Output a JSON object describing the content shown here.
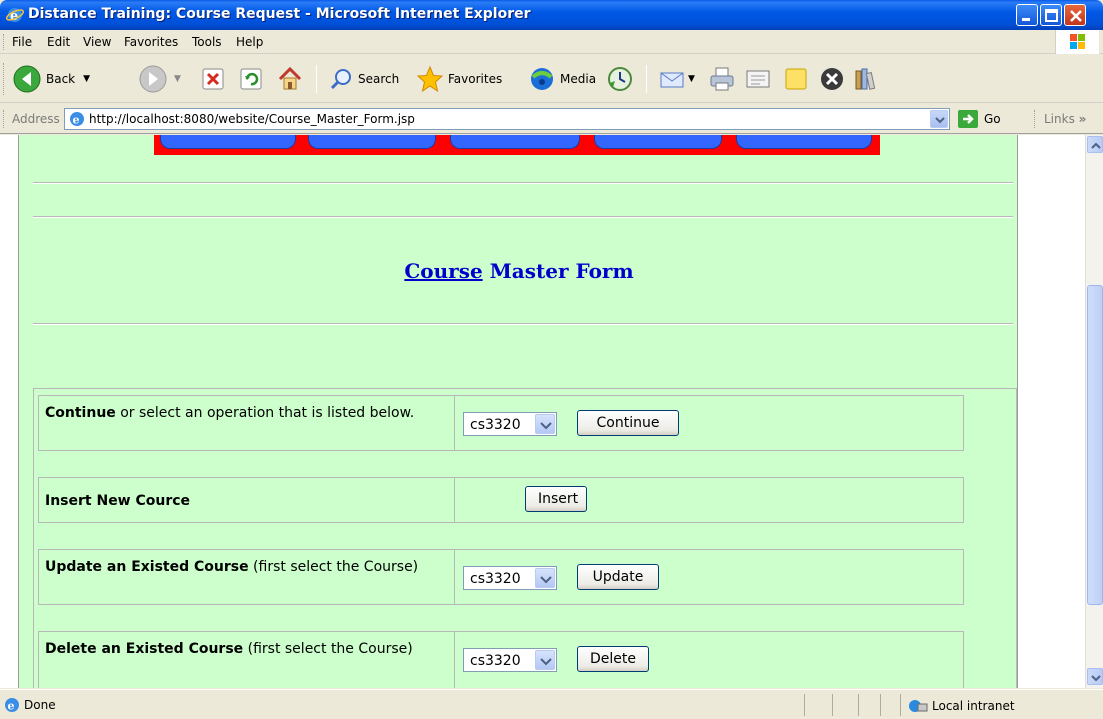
{
  "window": {
    "title": "Distance Training: Course Request - Microsoft Internet Explorer"
  },
  "menu": [
    "File",
    "Edit",
    "View",
    "Favorites",
    "Tools",
    "Help"
  ],
  "toolbar": {
    "back": "Back",
    "search": "Search",
    "favorites": "Favorites",
    "media": "Media"
  },
  "address": {
    "label": "Address",
    "url": "http://localhost:8080/website/Course_Master_Form.jsp",
    "go": "Go",
    "links": "Links"
  },
  "page": {
    "title_link": "Course",
    "title_rest": " Master Form",
    "rows": [
      {
        "bold": "Continue",
        "rest": " or select an operation that is listed below.",
        "select": "cs3320",
        "button": "Continue"
      },
      {
        "bold": "Insert New Cource",
        "rest": "",
        "select": "",
        "button": "Insert"
      },
      {
        "bold": "Update an Existed Course",
        "rest": " (first select the Course)",
        "select": "cs3320",
        "button": "Update"
      },
      {
        "bold": "Delete an Existed Course",
        "rest": " (first select the Course)",
        "select": "cs3320",
        "button": "Delete"
      }
    ]
  },
  "status": {
    "text": "Done",
    "zone": "Local intranet"
  },
  "colors": {
    "page_bg": "#ccffcc",
    "title": "#0000cc",
    "banner": "#ff0000"
  }
}
